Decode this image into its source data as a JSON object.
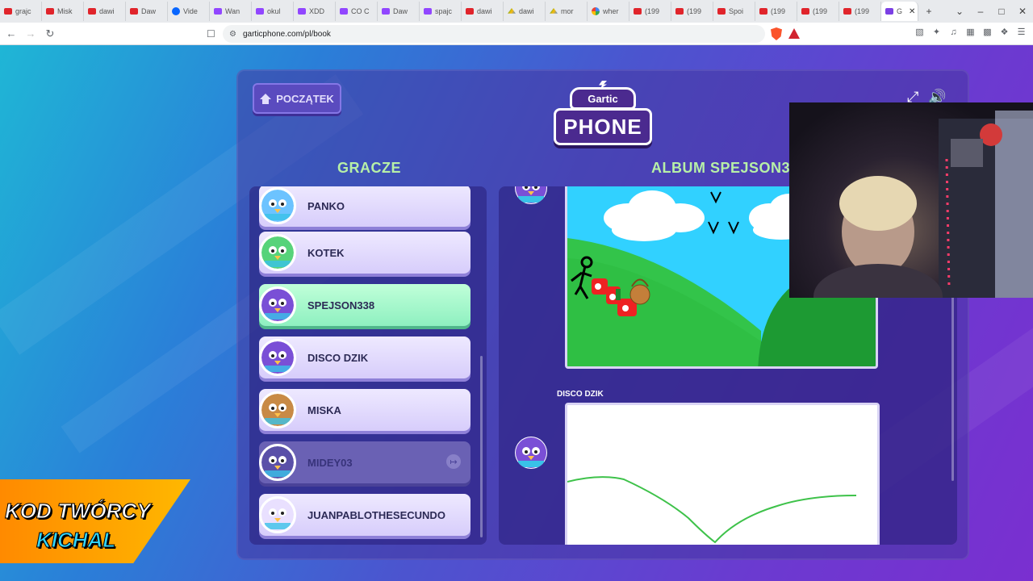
{
  "browser": {
    "tabs": [
      {
        "title": "grajc",
        "fav": "yt"
      },
      {
        "title": "Misk",
        "fav": "yt"
      },
      {
        "title": "dawi",
        "fav": "yt"
      },
      {
        "title": "Daw",
        "fav": "yt"
      },
      {
        "title": "Vide",
        "fav": "mt"
      },
      {
        "title": "Wan",
        "fav": "tw"
      },
      {
        "title": "okul",
        "fav": "tw"
      },
      {
        "title": "XDD",
        "fav": "tw"
      },
      {
        "title": "CO C",
        "fav": "tw"
      },
      {
        "title": "Daw",
        "fav": "tw"
      },
      {
        "title": "spajc",
        "fav": "tw"
      },
      {
        "title": "dawi",
        "fav": "yt"
      },
      {
        "title": "dawi",
        "fav": "dr"
      },
      {
        "title": "mor",
        "fav": "dr"
      },
      {
        "title": "wher",
        "fav": "go"
      },
      {
        "title": "(199",
        "fav": "yt"
      },
      {
        "title": "(199",
        "fav": "yt"
      },
      {
        "title": "Spoi",
        "fav": "yt"
      },
      {
        "title": "(199",
        "fav": "yt"
      },
      {
        "title": "(199",
        "fav": "yt"
      },
      {
        "title": "(199",
        "fav": "yt"
      }
    ],
    "active_tab": {
      "title": "G"
    },
    "url": "garticphone.com/pl/book",
    "icons": {
      "back": "back-arrow-icon",
      "forward": "forward-arrow-icon",
      "reload": "reload-icon",
      "bookmark": "bookmark-icon",
      "site_info": "site-info-icon",
      "brave": "brave-shield-icon",
      "rewards": "brave-rewards-icon",
      "new_tab": "plus-icon"
    }
  },
  "game": {
    "home_button": "POCZĄTEK",
    "logo": {
      "top": "Gartic",
      "bottom": "PHONE"
    },
    "players_title": "GRACZE",
    "album_title": "ALBUM SPEJSON338",
    "players": [
      {
        "name": "PANKO",
        "state": "normal",
        "avatar_color": "#6cc3ff"
      },
      {
        "name": "KOTEK",
        "state": "normal",
        "avatar_color": "#57d37a"
      },
      {
        "name": "SPEJSON338",
        "state": "active",
        "avatar_color": "#7a4fd6"
      },
      {
        "name": "DISCO DZIK",
        "state": "normal",
        "avatar_color": "#7a4fd6"
      },
      {
        "name": "MISKA",
        "state": "normal",
        "avatar_color": "#c88a45"
      },
      {
        "name": "MIDEY03",
        "state": "away",
        "avatar_color": "#5a50a8"
      },
      {
        "name": "JUANPABLOTHESECUNDO",
        "state": "normal",
        "avatar_color": "#e9e0ff"
      }
    ],
    "album_entries": [
      {
        "author": "DISCO DZIK"
      }
    ],
    "colors": {
      "accent_green": "#b7f0a7",
      "panel": "#4b3aa8",
      "active_player": "#8ef0c0"
    }
  },
  "overlay": {
    "promo_line1": "KOD TWÓRCY",
    "promo_line2": "KICHAL"
  }
}
